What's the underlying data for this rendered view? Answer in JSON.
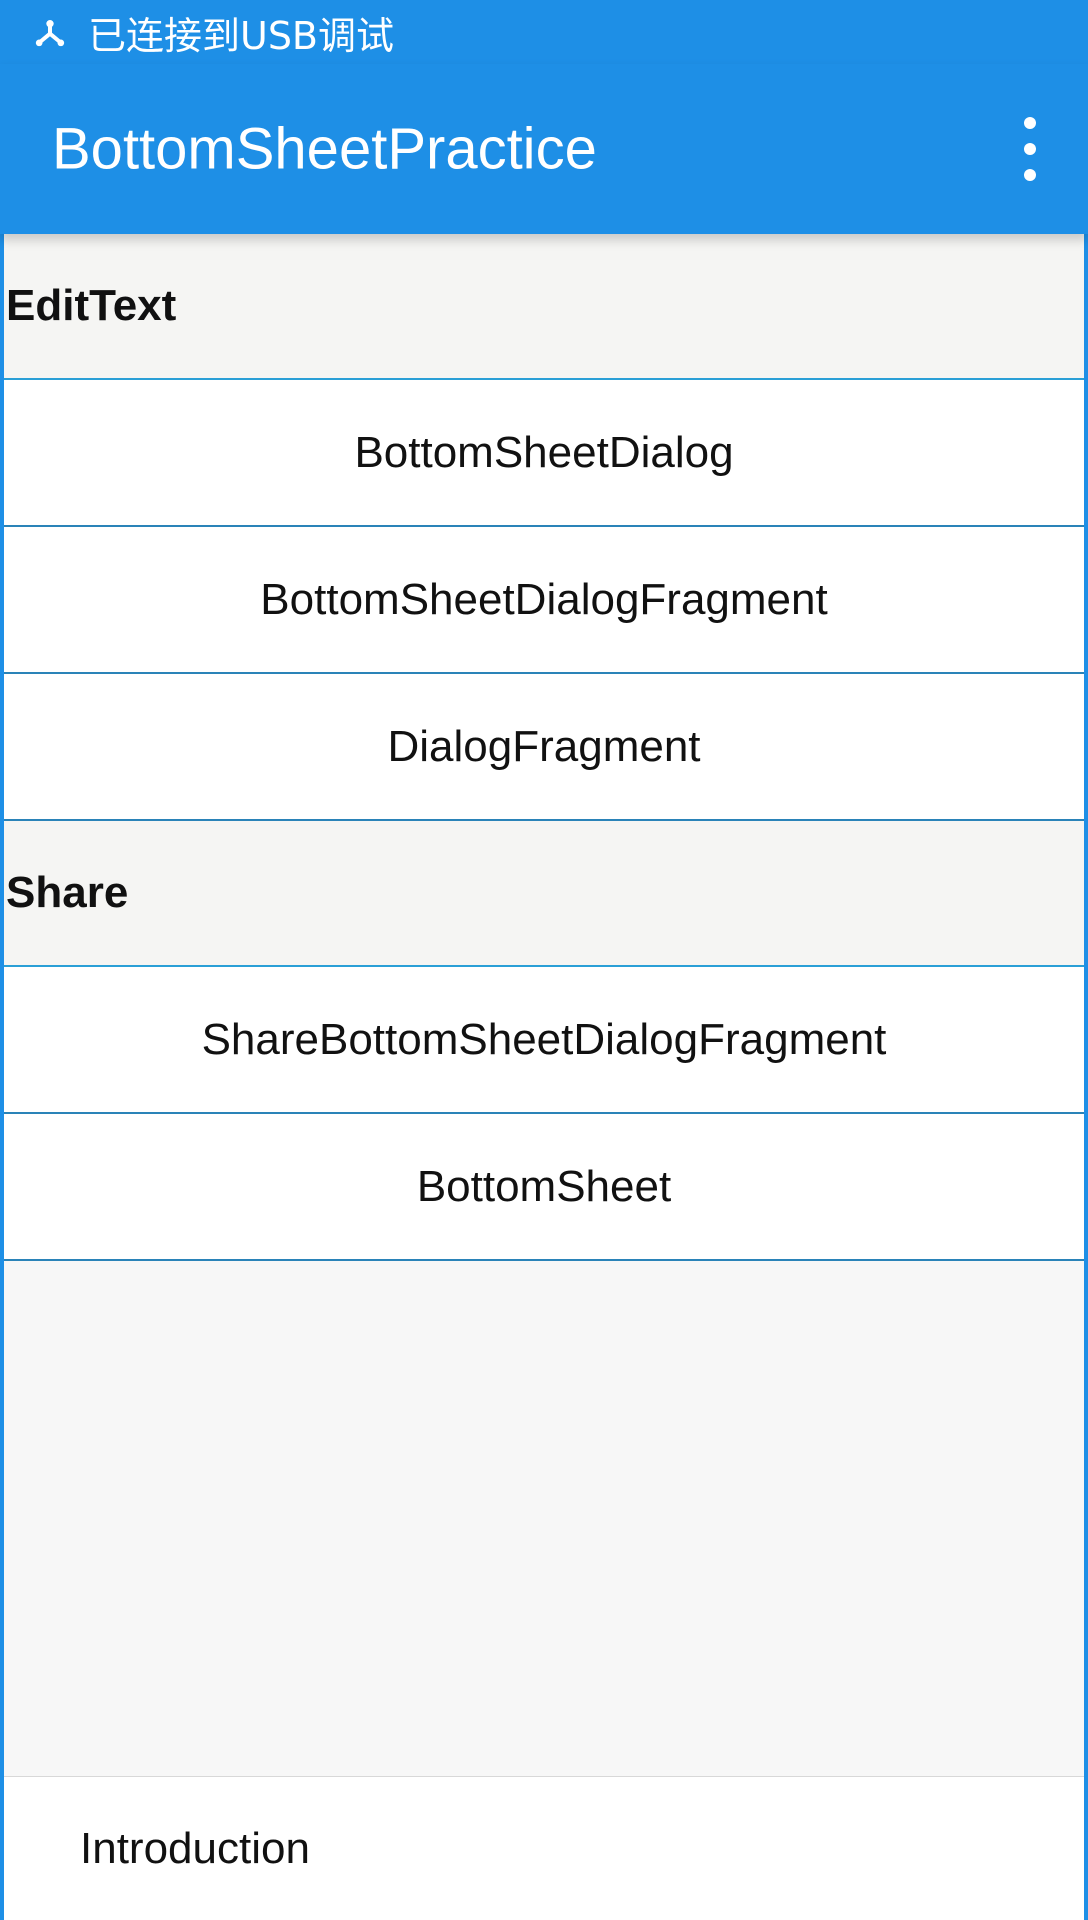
{
  "status_bar": {
    "icon": "usb-icon",
    "text": "已连接到USB调试"
  },
  "app_bar": {
    "title": "BottomSheetPractice",
    "overflow_icon": "more-vert-icon"
  },
  "sections": [
    {
      "header": "EditText",
      "buttons": [
        "BottomSheetDialog",
        "BottomSheetDialogFragment",
        "DialogFragment"
      ]
    },
    {
      "header": "Share",
      "buttons": [
        "ShareBottomSheetDialogFragment",
        "BottomSheet"
      ]
    }
  ],
  "bottom": {
    "intro_label": "Introduction"
  },
  "colors": {
    "primary": "#1e8fe6",
    "divider": "#2a9fd6"
  }
}
